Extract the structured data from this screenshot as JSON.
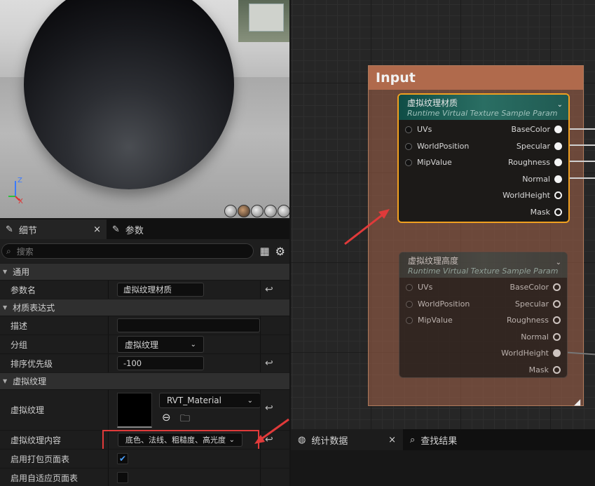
{
  "viewport": {
    "axis_z": "Z",
    "axis_x": "X"
  },
  "details": {
    "tabs": [
      {
        "label": "细节",
        "close": "×"
      },
      {
        "label": "参数"
      }
    ],
    "search_placeholder": "搜索",
    "sections": {
      "general": "通用",
      "material_expression": "材质表达式",
      "virtual_texture": "虚拟纹理"
    },
    "props": {
      "param_name": {
        "label": "参数名",
        "value": "虚拟纹理材质"
      },
      "description": {
        "label": "描述",
        "value": ""
      },
      "group": {
        "label": "分组",
        "value": "虚拟纹理"
      },
      "sort_priority": {
        "label": "排序优先级",
        "value": "-100"
      },
      "virtual_texture": {
        "label": "虚拟纹理",
        "asset": "RVT_Material"
      },
      "vt_content": {
        "label": "虚拟纹理内容",
        "value": "底色、法线、粗糙度、高光度"
      },
      "packed_table": {
        "label": "启用打包页面表"
      },
      "adaptive_table": {
        "label": "启用自适应页面表"
      }
    }
  },
  "graph": {
    "comment_title": "Input",
    "node1": {
      "title": "虚拟纹理材质",
      "subtitle": "Runtime Virtual Texture Sample Param",
      "inputs": [
        "UVs",
        "WorldPosition",
        "MipValue"
      ],
      "outputs": [
        "BaseColor",
        "Specular",
        "Roughness",
        "Normal",
        "WorldHeight",
        "Mask"
      ]
    },
    "node2": {
      "title": "虚拟纹理高度",
      "subtitle": "Runtime Virtual Texture Sample Param",
      "inputs": [
        "UVs",
        "WorldPosition",
        "MipValue"
      ],
      "outputs": [
        "BaseColor",
        "Specular",
        "Roughness",
        "Normal",
        "WorldHeight",
        "Mask"
      ]
    }
  },
  "bottom_tabs": [
    {
      "label": "统计数据",
      "close": "×"
    },
    {
      "label": "查找结果"
    }
  ],
  "colors": {
    "selected_node": "#f0a020",
    "comment": "#b06a4c",
    "annotation": "#e03a3a",
    "checkbox": "#4aa0ff"
  }
}
